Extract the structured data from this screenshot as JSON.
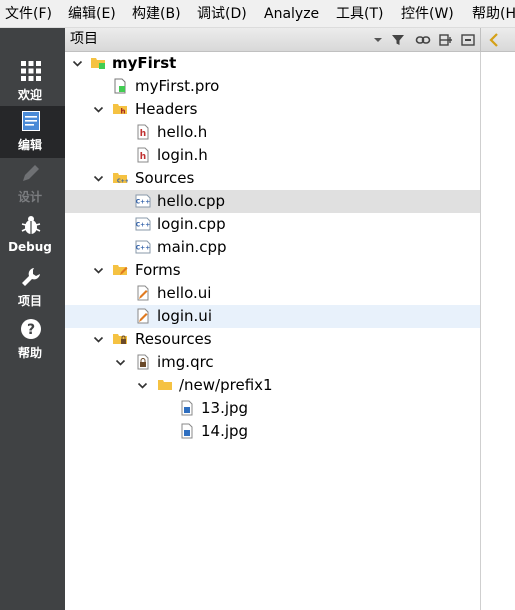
{
  "menubar": {
    "items": [
      "文件(F)",
      "编辑(E)",
      "构建(B)",
      "调试(D)",
      "Analyze",
      "工具(T)",
      "控件(W)",
      "帮助(H)"
    ]
  },
  "modebar": {
    "welcome": "欢迎",
    "edit": "编辑",
    "design": "设计",
    "debug": "Debug",
    "projects": "项目",
    "help": "帮助"
  },
  "pane": {
    "title": "项目"
  },
  "tree": {
    "root": "myFirst",
    "pro_file": "myFirst.pro",
    "headers": "Headers",
    "hello_h": "hello.h",
    "login_h": "login.h",
    "sources": "Sources",
    "hello_cpp": "hello.cpp",
    "login_cpp": "login.cpp",
    "main_cpp": "main.cpp",
    "forms": "Forms",
    "hello_ui": "hello.ui",
    "login_ui": "login.ui",
    "resources": "Resources",
    "img_qrc": "img.qrc",
    "prefix": "/new/prefix1",
    "jpg13": "13.jpg",
    "jpg14": "14.jpg"
  },
  "colors": {
    "modebar_bg": "#404244",
    "modebar_active": "#262729",
    "selected_row": "#e0e0e0",
    "hover_row": "#e8f1fb",
    "folder": "#f5c242"
  },
  "icons": [
    "grid-icon",
    "edit-doc-icon",
    "pencil-icon",
    "bug-icon",
    "wrench-icon",
    "question-icon",
    "filter-icon",
    "link-icon",
    "split-icon",
    "close-pane-icon",
    "chevron-left-icon",
    "folder-icon",
    "header-file-icon",
    "cpp-file-icon",
    "ui-file-icon",
    "qrc-file-icon",
    "image-file-icon"
  ]
}
